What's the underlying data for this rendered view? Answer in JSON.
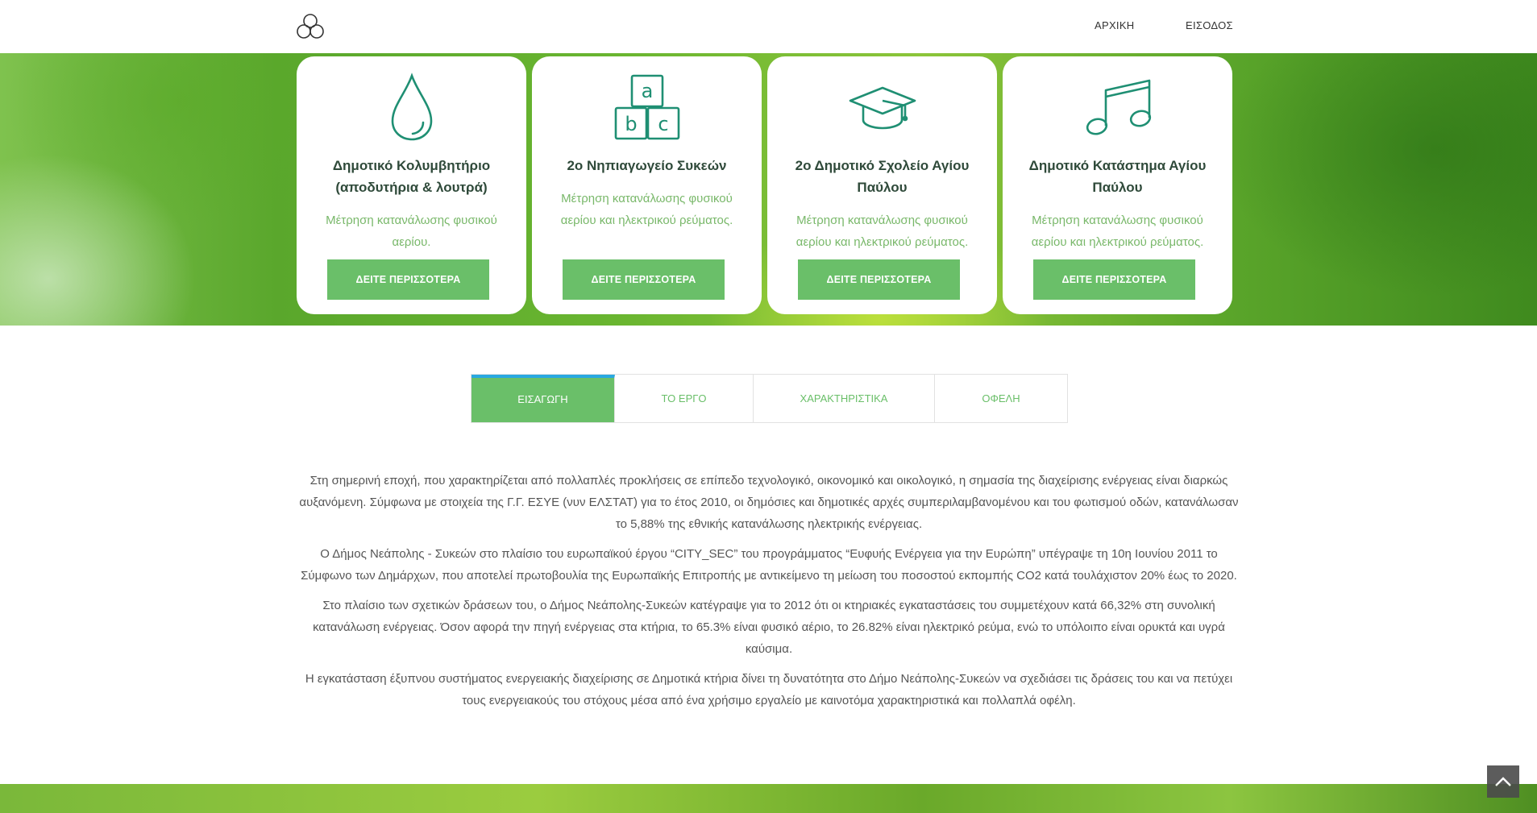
{
  "header": {
    "logo_icon": "recycle-circles-logo",
    "nav": {
      "home": "ΑΡΧΙΚΗ",
      "login": "ΕΙΣΟΔΟΣ"
    }
  },
  "cards": [
    {
      "icon": "water-drop-icon",
      "title": "Δημοτικό Κολυμβητήριο (αποδυτήρια & λουτρά)",
      "desc": "Μέτρηση κατανάλωσης φυσικού αερίου.",
      "button": "ΔΕΙΤΕ ΠΕΡΙΣΣΟΤΕΡΑ"
    },
    {
      "icon": "abc-blocks-icon",
      "title": "2ο Νηπιαγωγείο Συκεών",
      "desc": "Μέτρηση κατανάλωσης φυσικού αερίου και ηλεκτρικού ρεύματος.",
      "button": "ΔΕΙΤΕ ΠΕΡΙΣΣΟΤΕΡΑ"
    },
    {
      "icon": "graduation-cap-icon",
      "title": "2ο Δημοτικό Σχολείο Αγίου Παύλου",
      "desc": "Μέτρηση κατανάλωσης φυσικού αερίου και ηλεκτρικού ρεύματος.",
      "button": "ΔΕΙΤΕ ΠΕΡΙΣΣΟΤΕΡΑ"
    },
    {
      "icon": "music-notes-icon",
      "title": "Δημοτικό Κατάστημα Αγίου Παύλου",
      "desc": "Μέτρηση κατανάλωσης φυσικού αερίου και ηλεκτρικού ρεύματος.",
      "button": "ΔΕΙΤΕ ΠΕΡΙΣΣΟΤΕΡΑ"
    }
  ],
  "tabs": [
    {
      "label": "ΕΙΣΑΓΩΓΗ",
      "active": true
    },
    {
      "label": "ΤΟ ΕΡΓΟ",
      "active": false
    },
    {
      "label": "ΧΑΡΑΚΤΗΡΙΣΤΙΚΑ",
      "active": false
    },
    {
      "label": "ΟΦΕΛΗ",
      "active": false
    }
  ],
  "intro": {
    "paragraphs": [
      "Στη σημερινή εποχή, που χαρακτηρίζεται από πολλαπλές προκλήσεις σε επίπεδο τεχνολογικό, οικονομικό και οικολογικό, η σημασία της διαχείρισης ενέργειας είναι διαρκώς αυξανόμενη. Σύμφωνα με στοιχεία της Γ.Γ. ΕΣΥΕ (νυν ΕΛΣΤΑΤ) για το έτος 2010, οι δημόσιες και δημοτικές αρχές συμπεριλαμβανομένου και του φωτισμού οδών, κατανάλωσαν το 5,88% της εθνικής κατανάλωσης ηλεκτρικής ενέργειας.",
      "Ο Δήμος Νεάπολης - Συκεών στο πλαίσιο του ευρωπαϊκού έργου “CITY_SEC” του προγράμματος “Ευφυής Ενέργεια για την Ευρώπη” υπέγραψε τη 10η Ιουνίου 2011 το Σύμφωνο των Δημάρχων, που αποτελεί πρωτοβουλία της Ευρωπαϊκής Επιτροπής με αντικείμενο τη μείωση του ποσοστού εκπομπής CO2 κατά τουλάχιστον 20% έως το 2020.",
      "Στο πλαίσιο των σχετικών δράσεων του, ο Δήμος Νεάπολης-Συκεών κατέγραψε για το 2012 ότι οι κτηριακές εγκαταστάσεις του συμμετέχουν κατά 66,32% στη συνολική κατανάλωση ενέργειας. Όσον αφορά την πηγή ενέργειας στα κτήρια, το 65.3% είναι φυσικό αέριο, το 26.82% είναι ηλεκτρικό ρεύμα, ενώ το υπόλοιπο είναι ορυκτά και υγρά καύσιμα.",
      "Η εγκατάσταση έξυπνου συστήματος ενεργειακής διαχείρισης σε Δημοτικά κτήρια δίνει τη δυνατότητα στο Δήμο Νεάπολης-Συκεών να σχεδιάσει τις δράσεις του και να πετύχει τους ενεργειακούς του στόχους μέσα από ένα χρήσιμο εργαλείο με καινοτόμα χαρακτηριστικά και πολλαπλά οφέλη."
    ]
  },
  "scroll_top_icon": "chevron-up-icon",
  "colors": {
    "accent": "#6abf69",
    "tab_indicator": "#29a8e0",
    "icon": "#1f8f73",
    "title": "#2f4a3a"
  }
}
